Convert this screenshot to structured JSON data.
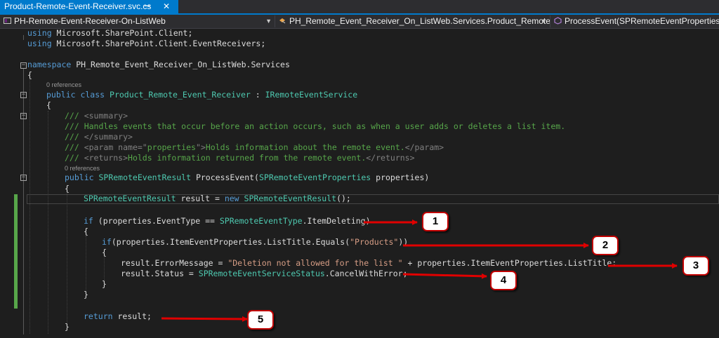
{
  "tab": {
    "title": "Product-Remote-Event-Receiver.svc.cs",
    "pin_glyph": "⊸",
    "close_glyph": "✕"
  },
  "navbar": {
    "project": "PH-Remote-Event-Receiver-On-ListWeb",
    "type": "PH_Remote_Event_Receiver_On_ListWeb.Services.Product_Remote_Eve",
    "member": "ProcessEvent(SPRemoteEventProperties prop"
  },
  "code": {
    "using1": {
      "kw": "using",
      "text": " Microsoft.SharePoint.Client;"
    },
    "using2": {
      "kw": "using",
      "text": " Microsoft.SharePoint.Client.EventReceivers;"
    },
    "namespace": {
      "kw": "namespace",
      "text": " PH_Remote_Event_Receiver_On_ListWeb.Services"
    },
    "brace_open_ns": "{",
    "refs_class": "0 references",
    "class_decl": {
      "kw": "public class",
      "name": " Product_Remote_Event_Receiver",
      "sep": " : ",
      "iface": "IRemoteEventService"
    },
    "brace_open_class": "{",
    "doc1": {
      "a": "/// ",
      "b": "<summary>"
    },
    "doc2": "/// Handles events that occur before an action occurs, such as when a user adds or deletes a list item.",
    "doc3": {
      "a": "/// ",
      "b": "</summary>"
    },
    "doc4": {
      "a": "/// ",
      "b": "<param name=\"",
      "c": "properties",
      "d": "\">",
      "e": "Holds information about the remote event.",
      "f": "</param>"
    },
    "doc5": {
      "a": "/// ",
      "b": "<returns>",
      "e": "Holds information returned from the remote event.",
      "f": "</returns>"
    },
    "refs_method": "0 references",
    "method_decl": {
      "kw": "public",
      "ret": " SPRemoteEventResult",
      "name": " ProcessEvent(",
      "ptype": "SPRemoteEventProperties",
      "rest": " properties)"
    },
    "brace_open_method": "{",
    "result_decl": {
      "t1": "SPRemoteEventResult",
      "mid": " result = ",
      "kw": "new",
      "t2": " SPRemoteEventResult",
      "end": "();"
    },
    "if1": {
      "kw": "if",
      "a": " (properties.EventType == ",
      "ty": "SPRemoteEventType",
      "b": ".ItemDeleting)"
    },
    "brace_open_if1": "{",
    "if2": {
      "kw": "if",
      "a": "(properties.ItemEventProperties.ListTitle.Equals(",
      "str": "\"Products\"",
      "b": "))"
    },
    "brace_open_if2": "{",
    "err_line": {
      "a": "result.ErrorMessage = ",
      "str": "\"Deletion not allowed for the list \"",
      "b": " + properties.ItemEventProperties.ListTitle;"
    },
    "status_line": {
      "a": "result.Status = ",
      "ty": "SPRemoteEventServiceStatus",
      "b": ".CancelWithError;"
    },
    "brace_close_if2": "}",
    "brace_close_if1": "}",
    "return_line": {
      "kw": "return",
      "b": " result;"
    },
    "brace_close_method": "}"
  },
  "annotations": {
    "badge1": "1",
    "badge2": "2",
    "badge3": "3",
    "badge4": "4",
    "badge5": "5",
    "arrow_color": "#e00000"
  }
}
